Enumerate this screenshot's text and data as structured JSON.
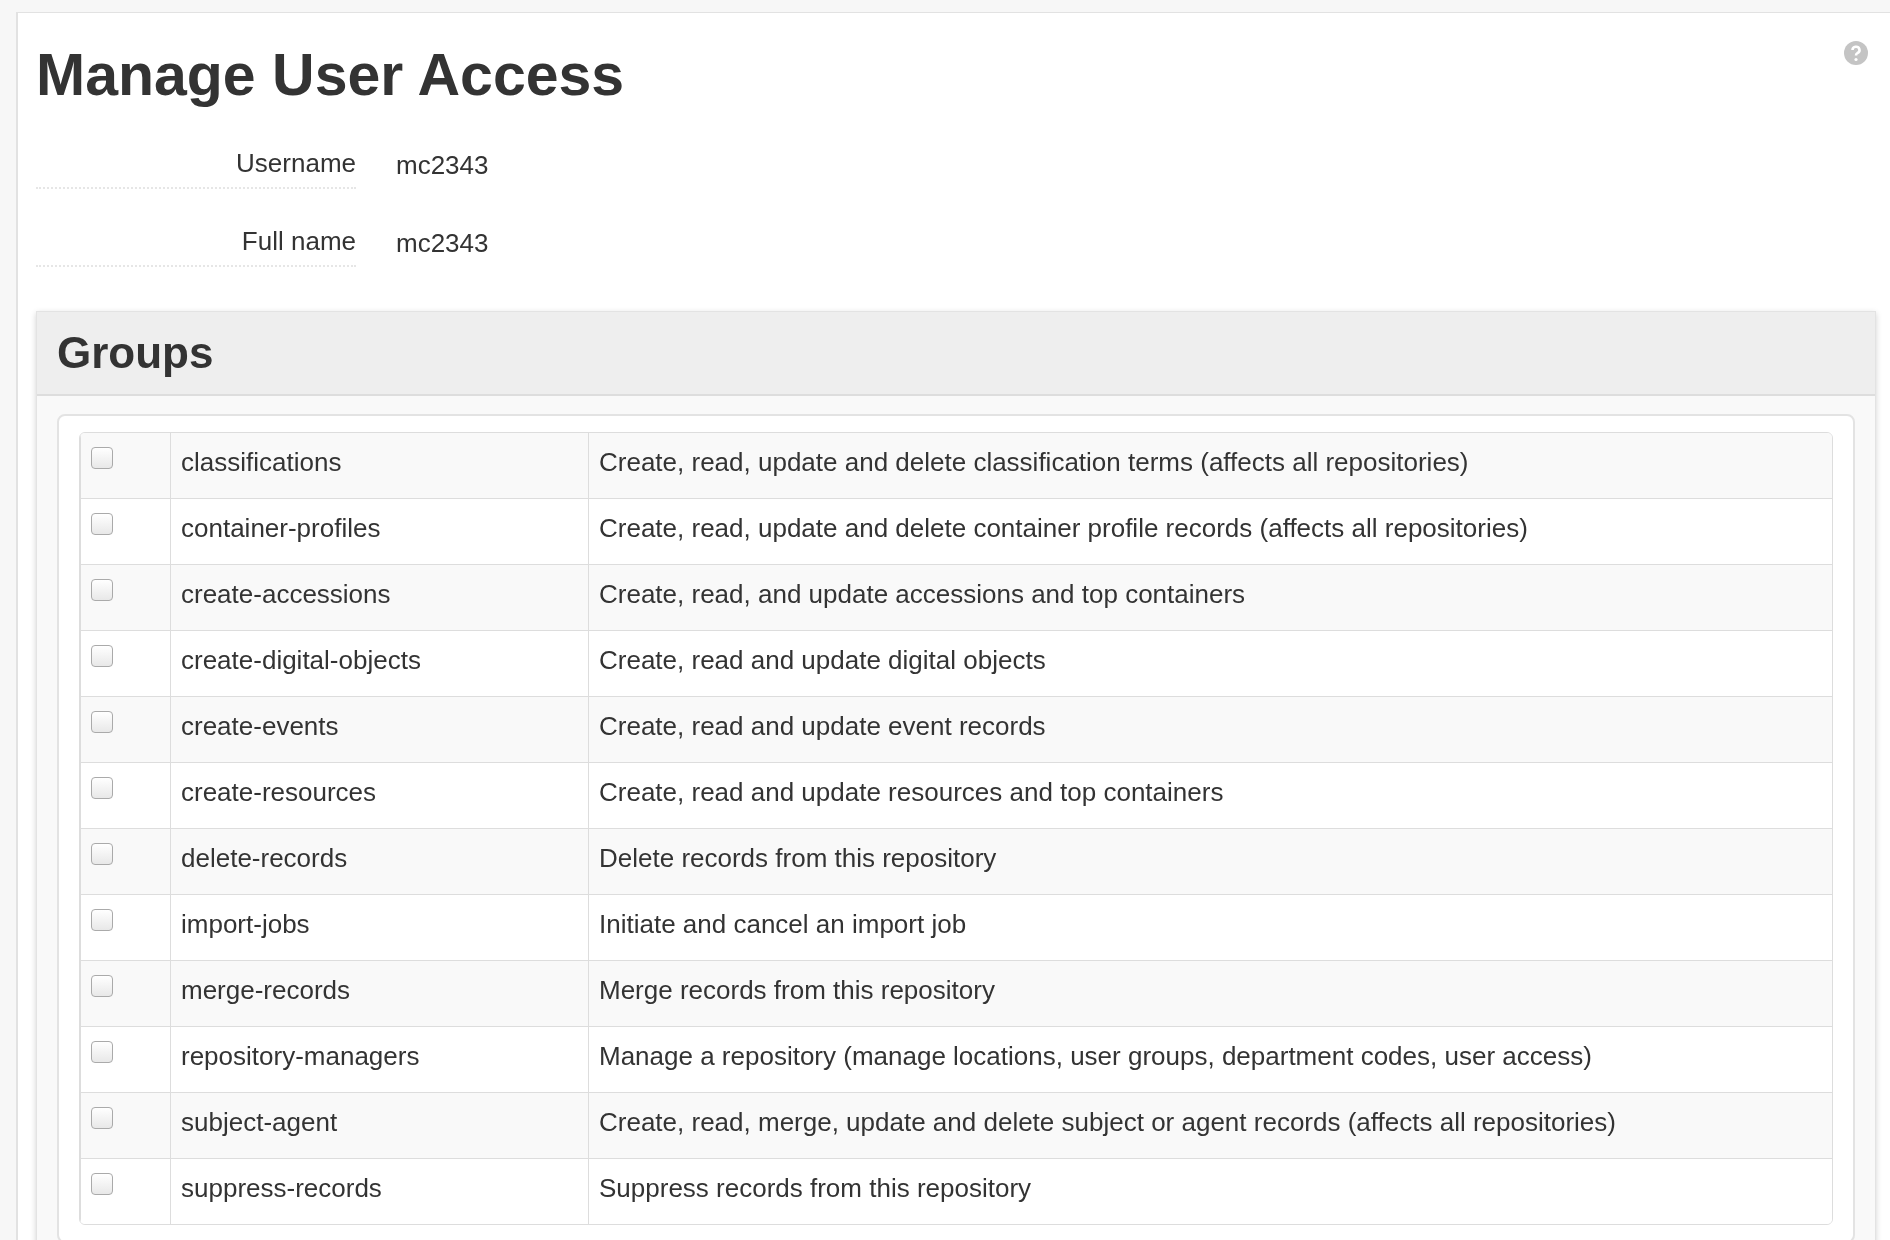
{
  "title": "Manage User Access",
  "fields": [
    {
      "label": "Username",
      "value": "mc2343"
    },
    {
      "label": "Full name",
      "value": "mc2343"
    }
  ],
  "groups": {
    "heading": "Groups",
    "rows": [
      {
        "name": "classifications",
        "description": "Create, read, update and delete classification terms (affects all repositories)",
        "checked": false
      },
      {
        "name": "container-profiles",
        "description": "Create, read, update and delete container profile records (affects all repositories)",
        "checked": false
      },
      {
        "name": "create-accessions",
        "description": "Create, read, and update accessions and top containers",
        "checked": false
      },
      {
        "name": "create-digital-objects",
        "description": "Create, read and update digital objects",
        "checked": false
      },
      {
        "name": "create-events",
        "description": "Create, read and update event records",
        "checked": false
      },
      {
        "name": "create-resources",
        "description": "Create, read and update resources and top containers",
        "checked": false
      },
      {
        "name": "delete-records",
        "description": "Delete records from this repository",
        "checked": false
      },
      {
        "name": "import-jobs",
        "description": "Initiate and cancel an import job",
        "checked": false
      },
      {
        "name": "merge-records",
        "description": "Merge records from this repository",
        "checked": false
      },
      {
        "name": "repository-managers",
        "description": "Manage a repository (manage locations, user groups, department codes, user access)",
        "checked": false
      },
      {
        "name": "subject-agent",
        "description": "Create, read, merge, update and delete subject or agent records (affects all repositories)",
        "checked": false
      },
      {
        "name": "suppress-records",
        "description": "Suppress records from this repository",
        "checked": false
      }
    ]
  }
}
